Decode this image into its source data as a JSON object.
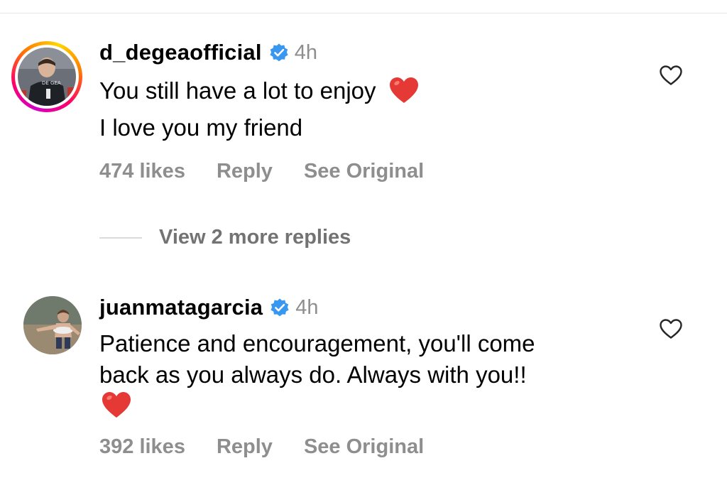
{
  "comments": [
    {
      "username": "d_degeaofficial",
      "verified": true,
      "time": "4h",
      "text_lines": [
        "You still have a lot to enjoy",
        "I love you my friend"
      ],
      "emoji": "heart",
      "likes": "474 likes",
      "reply_label": "Reply",
      "translate_label": "See Original",
      "avatar_has_story_ring": true
    },
    {
      "username": "juanmatagarcia",
      "verified": true,
      "time": "4h",
      "text_lines": [
        "Patience and encouragement, you'll come",
        "back as you always do. Always with you!!"
      ],
      "emoji": "heart",
      "likes": "392 likes",
      "reply_label": "Reply",
      "translate_label": "See Original",
      "avatar_has_story_ring": false
    }
  ],
  "view_more_replies": "View 2 more replies",
  "colors": {
    "verified_blue": "#3897f0",
    "muted_text": "#8e8e8e",
    "heart_red": "#e0245e"
  },
  "icons": {
    "verified": "verified-badge-icon",
    "like": "heart-outline-icon",
    "emoji": "red-heart-emoji"
  }
}
